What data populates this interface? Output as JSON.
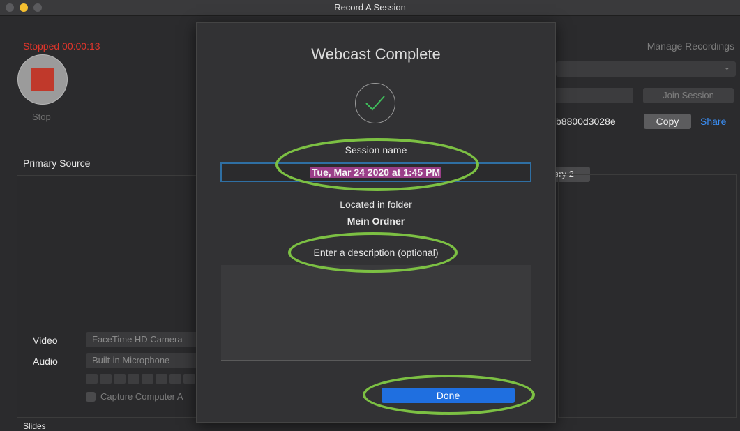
{
  "window": {
    "title": "Record A Session"
  },
  "recorder": {
    "status": "Stopped  00:00:13",
    "stop_label": "Stop",
    "primary_source_label": "Primary Source",
    "video_label": "Video",
    "video_value": "FaceTime HD Camera",
    "audio_label": "Audio",
    "audio_value": "Built-in Microphone",
    "capture_label": "Capture Computer A",
    "slides_hint": "Slides"
  },
  "right_pane": {
    "manage_recordings": "Manage Recordings",
    "join_session": "Join Session",
    "session_id": "b8800d3028e",
    "copy": "Copy",
    "share": "Share",
    "secondary_tab": "ary 2"
  },
  "modal": {
    "title": "Webcast Complete",
    "session_name_label": "Session name",
    "session_name_value": "Tue, Mar 24 2020 at 1:45 PM",
    "folder_label": "Located in folder",
    "folder_value": "Mein Ordner",
    "description_label": "Enter a description (optional)",
    "description_value": "",
    "done": "Done"
  },
  "colors": {
    "accent_blue": "#1f6fe0",
    "stop_red": "#e0352b",
    "annotation_green": "#7cc043",
    "check_green": "#3fbf5b"
  }
}
